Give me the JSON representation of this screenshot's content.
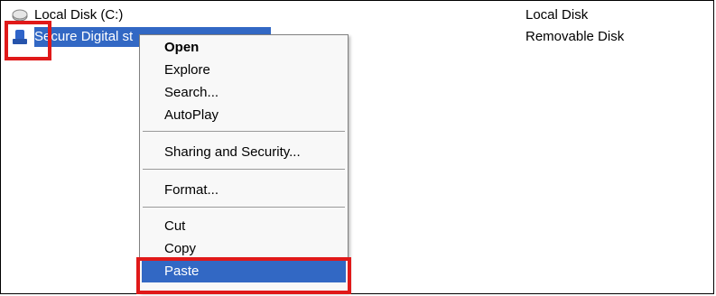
{
  "drives": [
    {
      "name": "Local Disk (C:)",
      "type": "Local Disk",
      "icon": "hard-disk-icon"
    },
    {
      "name": "Secure Digital st",
      "type": "Removable Disk",
      "icon": "removable-disk-icon"
    }
  ],
  "context_menu": {
    "items": [
      "Open",
      "Explore",
      "Search...",
      "AutoPlay",
      "Sharing and Security...",
      "Format...",
      "Cut",
      "Copy",
      "Paste"
    ]
  },
  "colors": {
    "selection": "#3268c4",
    "highlight_box": "#e01919"
  }
}
